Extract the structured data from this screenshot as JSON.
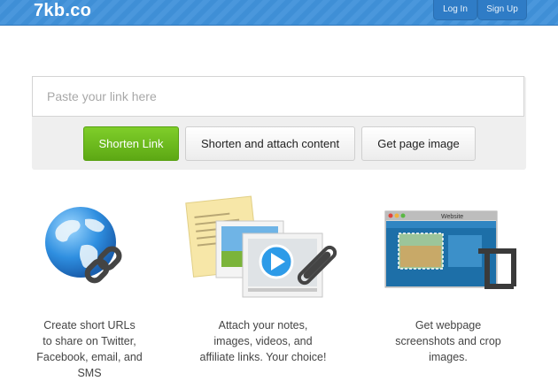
{
  "header": {
    "logo": "7kb.co",
    "login_label": "Log In",
    "signup_label": "Sign Up"
  },
  "shortener": {
    "placeholder": "Paste your link here",
    "shorten_label": "Shorten Link",
    "attach_label": "Shorten and attach content",
    "image_label": "Get page image"
  },
  "features": [
    {
      "icon": "globe-link-icon",
      "lines": [
        "Create short URLs",
        "to share on Twitter,",
        "Facebook, email, and",
        "SMS"
      ]
    },
    {
      "icon": "media-attach-icon",
      "lines": [
        "Attach your notes,",
        "images, videos, and",
        "affiliate links. Your choice!"
      ]
    },
    {
      "icon": "screenshot-crop-icon",
      "window_title": "Website",
      "lines": [
        "Get webpage",
        "screenshots and crop",
        "images."
      ]
    }
  ],
  "colors": {
    "header_blue": "#3f8fd6",
    "accent_green": "#6cbd1e"
  }
}
